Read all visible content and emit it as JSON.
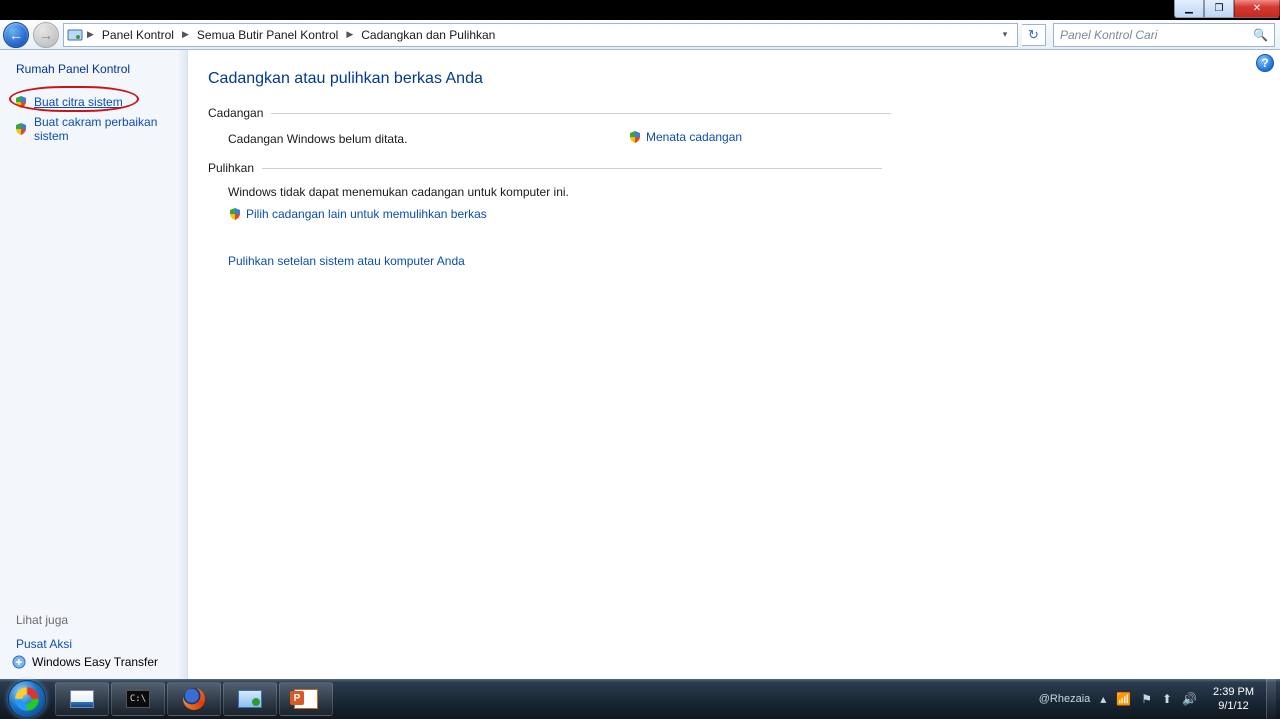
{
  "caption": {
    "min": "—",
    "max": "❐",
    "close": "✕"
  },
  "breadcrumb": {
    "items": [
      "Panel Kontrol",
      "Semua Butir Panel Kontrol",
      "Cadangkan dan Pulihkan"
    ]
  },
  "search": {
    "placeholder": "Panel Kontrol Cari"
  },
  "sidebar": {
    "home": "Rumah Panel Kontrol",
    "link1": "Buat citra sistem",
    "link2": "Buat cakram perbaikan sistem",
    "see_also": "Lihat juga",
    "footer1": "Pusat Aksi",
    "footer2": "Windows Easy Transfer"
  },
  "main": {
    "title": "Cadangkan atau pulihkan berkas Anda",
    "backup_head": "Cadangan",
    "backup_msg": "Cadangan Windows belum ditata.",
    "setup_link": "Menata cadangan",
    "restore_head": "Pulihkan",
    "restore_msg": "Windows tidak dapat menemukan cadangan untuk komputer ini.",
    "restore_link1": "Pilih cadangan lain untuk memulihkan berkas",
    "restore_link2": "Pulihkan setelan sistem atau komputer Anda"
  },
  "tray": {
    "user": "@Rhezaia",
    "time": "2:39 PM",
    "date": "9/1/12"
  }
}
